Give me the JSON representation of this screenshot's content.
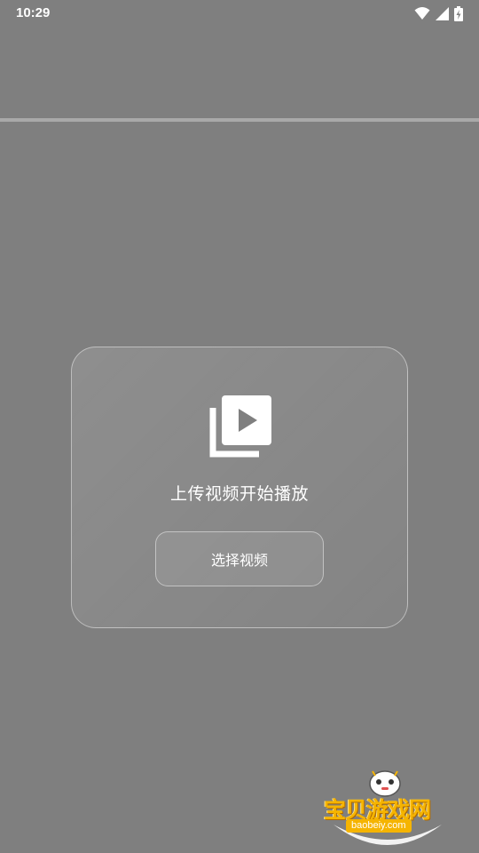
{
  "status_bar": {
    "time": "10:29"
  },
  "upload_card": {
    "icon": "video-library-icon",
    "title": "上传视频开始播放",
    "button_label": "选择视频"
  },
  "watermark": {
    "brand": "宝贝游戏网",
    "url": "baobeiy.com"
  },
  "colors": {
    "background": "#7f7f7f",
    "divider": "#a9a9a9",
    "text": "#ffffff",
    "watermark": "#f5b400"
  }
}
